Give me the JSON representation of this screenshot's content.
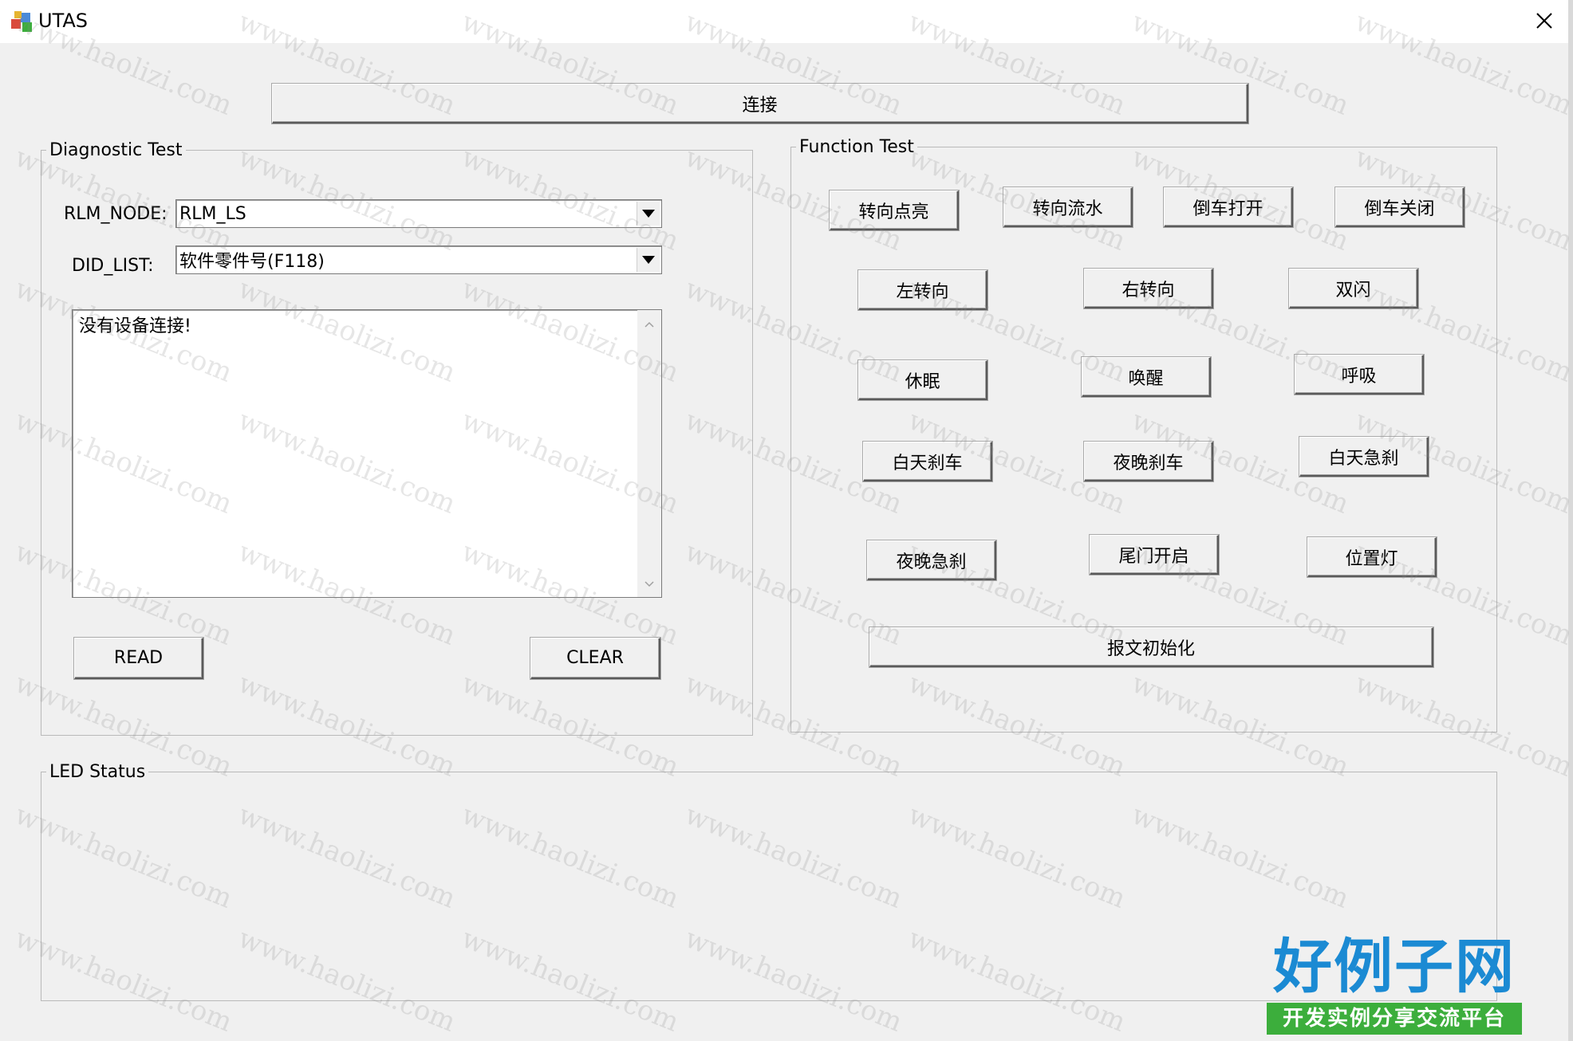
{
  "window": {
    "title": "UTAS"
  },
  "toolbar": {
    "connect_label": "连接"
  },
  "diagnostic": {
    "title": "Diagnostic Test",
    "rlm_node_label": "RLM_NODE:",
    "rlm_node_value": "RLM_LS",
    "did_list_label": "DID_LIST:",
    "did_list_value": "软件零件号(F118)",
    "log_text": "没有设备连接!",
    "read_label": "READ",
    "clear_label": "CLEAR"
  },
  "function": {
    "title": "Function Test",
    "buttons": [
      "转向点亮",
      "转向流水",
      "倒车打开",
      "倒车关闭",
      "左转向",
      "右转向",
      "双闪",
      "休眠",
      "唤醒",
      "呼吸",
      "白天刹车",
      "夜晚刹车",
      "白天急刹",
      "夜晚急刹",
      "尾门开启",
      "位置灯",
      "报文初始化"
    ]
  },
  "led": {
    "title": "LED Status"
  },
  "watermark": {
    "text": "www.haolizi.com"
  },
  "brand": {
    "main": "好例子网",
    "sub": "开发实例分享交流平台"
  },
  "icons": [
    "app-icon",
    "close-icon",
    "chevron-down-icon",
    "scroll-up-icon",
    "scroll-down-icon"
  ],
  "colors": {
    "brand_blue": "#1b8ad3",
    "brand_green": "#3cae3c"
  }
}
